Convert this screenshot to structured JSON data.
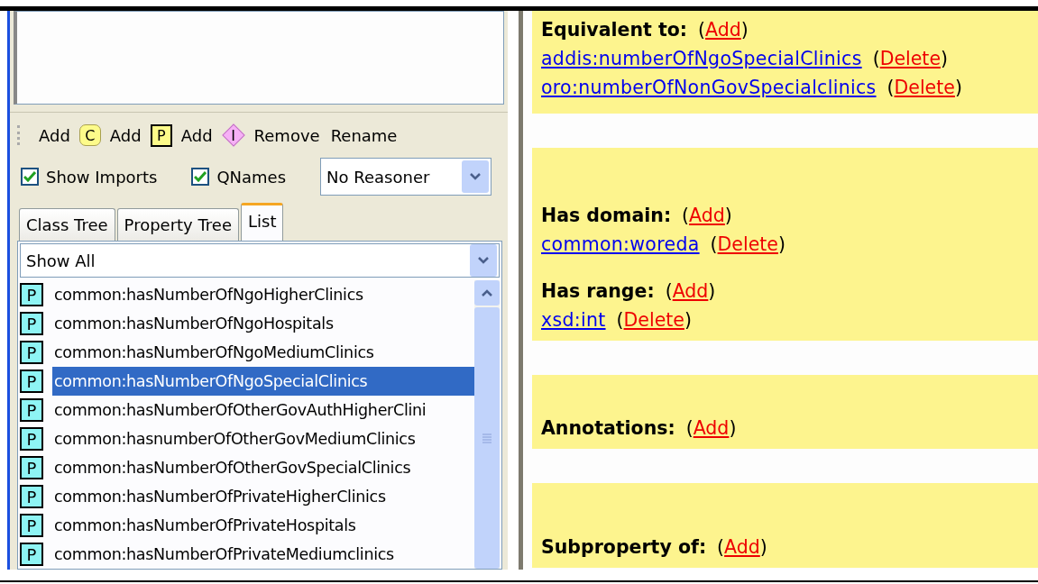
{
  "toolbar": [
    {
      "label": "Add",
      "kind": "class",
      "icon_text": "C"
    },
    {
      "label": "Add",
      "kind": "property",
      "icon_text": "P"
    },
    {
      "label": "Add",
      "kind": "individual",
      "icon_text": "I"
    },
    {
      "label": "Remove"
    },
    {
      "label": "Rename"
    }
  ],
  "options": [
    {
      "label": "Show Imports",
      "checked": true
    },
    {
      "label": "QNames",
      "checked": true
    }
  ],
  "reasoner": {
    "value": "No Reasoner"
  },
  "tabs": [
    {
      "label": "Class Tree",
      "selected": false
    },
    {
      "label": "Property Tree",
      "selected": false
    },
    {
      "label": "List",
      "selected": true
    }
  ],
  "filter": {
    "value": "Show All"
  },
  "list": [
    {
      "badge": "P",
      "text": "common:hasNumberOfNgoHigherClinics",
      "selected": false
    },
    {
      "badge": "P",
      "text": "common:hasNumberOfNgoHospitals",
      "selected": false
    },
    {
      "badge": "P",
      "text": "common:hasNumberOfNgoMediumClinics",
      "selected": false
    },
    {
      "badge": "P",
      "text": "common:hasNumberOfNgoSpecialClinics",
      "selected": true
    },
    {
      "badge": "P",
      "text": "common:hasNumberOfOtherGovAuthHigherClini",
      "selected": false
    },
    {
      "badge": "P",
      "text": "common:hasnumberOfOtherGovMediumClinics",
      "selected": false
    },
    {
      "badge": "P",
      "text": "common:hasNumberOfOtherGovSpecialClinics",
      "selected": false
    },
    {
      "badge": "P",
      "text": "common:hasNumberOfPrivateHigherClinics",
      "selected": false
    },
    {
      "badge": "P",
      "text": "common:hasNumberOfPrivateHospitals",
      "selected": false
    },
    {
      "badge": "P",
      "text": "common:hasNumberOfPrivateMediumclinics",
      "selected": false
    }
  ],
  "sections": [
    {
      "blocks": [
        {
          "heading": "Equivalent to:",
          "action": {
            "before": "(",
            "text": "Add",
            "after": ")"
          },
          "values": [
            {
              "text": "addis:numberOfNgoSpecialClinics",
              "action": {
                "before": "(",
                "text": "Delete",
                "after": ")"
              }
            },
            {
              "text": "oro:numberOfNonGovSpecialclinics",
              "action": {
                "before": "(",
                "text": "Delete",
                "after": ")"
              }
            }
          ]
        }
      ]
    },
    {
      "blocks": [
        {
          "heading": "Has domain:",
          "action": {
            "before": "(",
            "text": "Add",
            "after": ")"
          },
          "values": [
            {
              "text": "common:woreda",
              "action": {
                "before": "(",
                "text": "Delete",
                "after": ")"
              }
            }
          ]
        },
        {
          "heading": "Has range:",
          "action": {
            "before": "(",
            "text": "Add",
            "after": ")"
          },
          "values": [
            {
              "text": "xsd:int",
              "action": {
                "before": "(",
                "text": "Delete",
                "after": ")"
              }
            }
          ]
        }
      ]
    },
    {
      "blocks": [
        {
          "heading": "Annotations:",
          "action": {
            "before": "(",
            "text": "Add",
            "after": ")"
          }
        }
      ]
    },
    {
      "blocks": [
        {
          "heading": "Subproperty of:",
          "action": {
            "before": "(",
            "text": "Add",
            "after": ")"
          }
        }
      ]
    }
  ]
}
